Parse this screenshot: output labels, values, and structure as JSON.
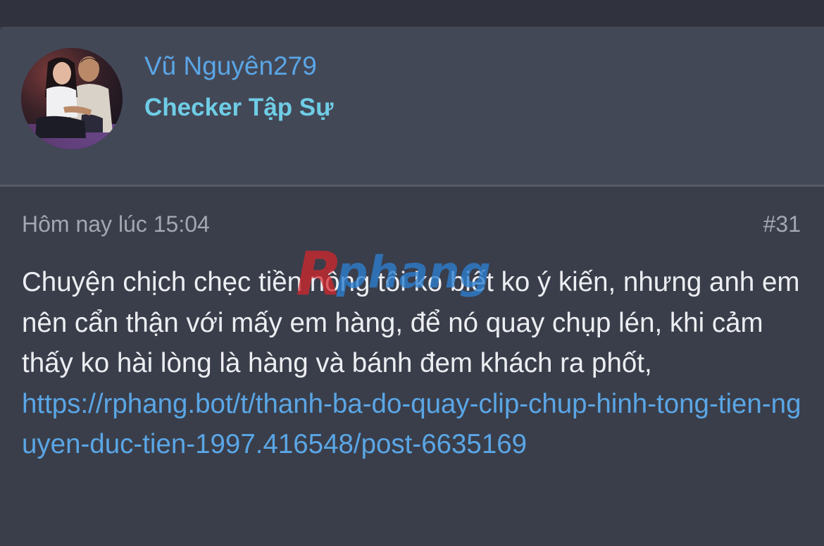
{
  "user": {
    "name": "Vũ Nguyên279",
    "title": "Checker Tập Sự"
  },
  "post": {
    "timestamp": "Hôm nay lúc 15:04",
    "number": "#31",
    "text": "Chuyện chịch chẹc tiền nông tôi ko biết ko ý kiến, nhưng anh em nên cẩn thận với mấy em hàng, để nó quay chụp lén, khi cảm thấy ko hài lòng là hàng và bánh đem khách ra phốt,",
    "link": "https://rphang.bot/t/thanh-ba-do-quay-clip-chup-hinh-tong-tien-nguyen-duc-tien-1997.416548/post-6635169"
  },
  "watermark": {
    "text": "Rphang"
  },
  "colors": {
    "username": "#5aa6e6",
    "user_title": "#6fcde6",
    "link": "#5aa6e6",
    "header_bg": "#434857",
    "body_bg": "#3a3e4a"
  },
  "icons": {
    "avatar": "avatar-photo"
  }
}
